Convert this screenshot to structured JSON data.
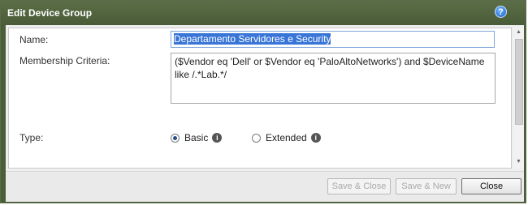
{
  "dialog": {
    "title": "Edit Device Group",
    "help_icon": "help-icon",
    "help_glyph": "?"
  },
  "form": {
    "name_label": "Name:",
    "name_value": "Departamento Servidores e Security",
    "criteria_label": "Membership Criteria:",
    "criteria_value": "($Vendor eq 'Dell' or $Vendor eq 'PaloAltoNetworks') and $DeviceName like /.*Lab.*/",
    "type_label": "Type:",
    "type_options": [
      {
        "label": "Basic",
        "selected": true
      },
      {
        "label": "Extended",
        "selected": false
      }
    ],
    "info_glyph": "i"
  },
  "buttons": {
    "save_close": "Save & Close",
    "save_new": "Save & New",
    "close": "Close"
  },
  "colors": {
    "titlebar": "#4f6240",
    "selection": "#3875d7"
  }
}
